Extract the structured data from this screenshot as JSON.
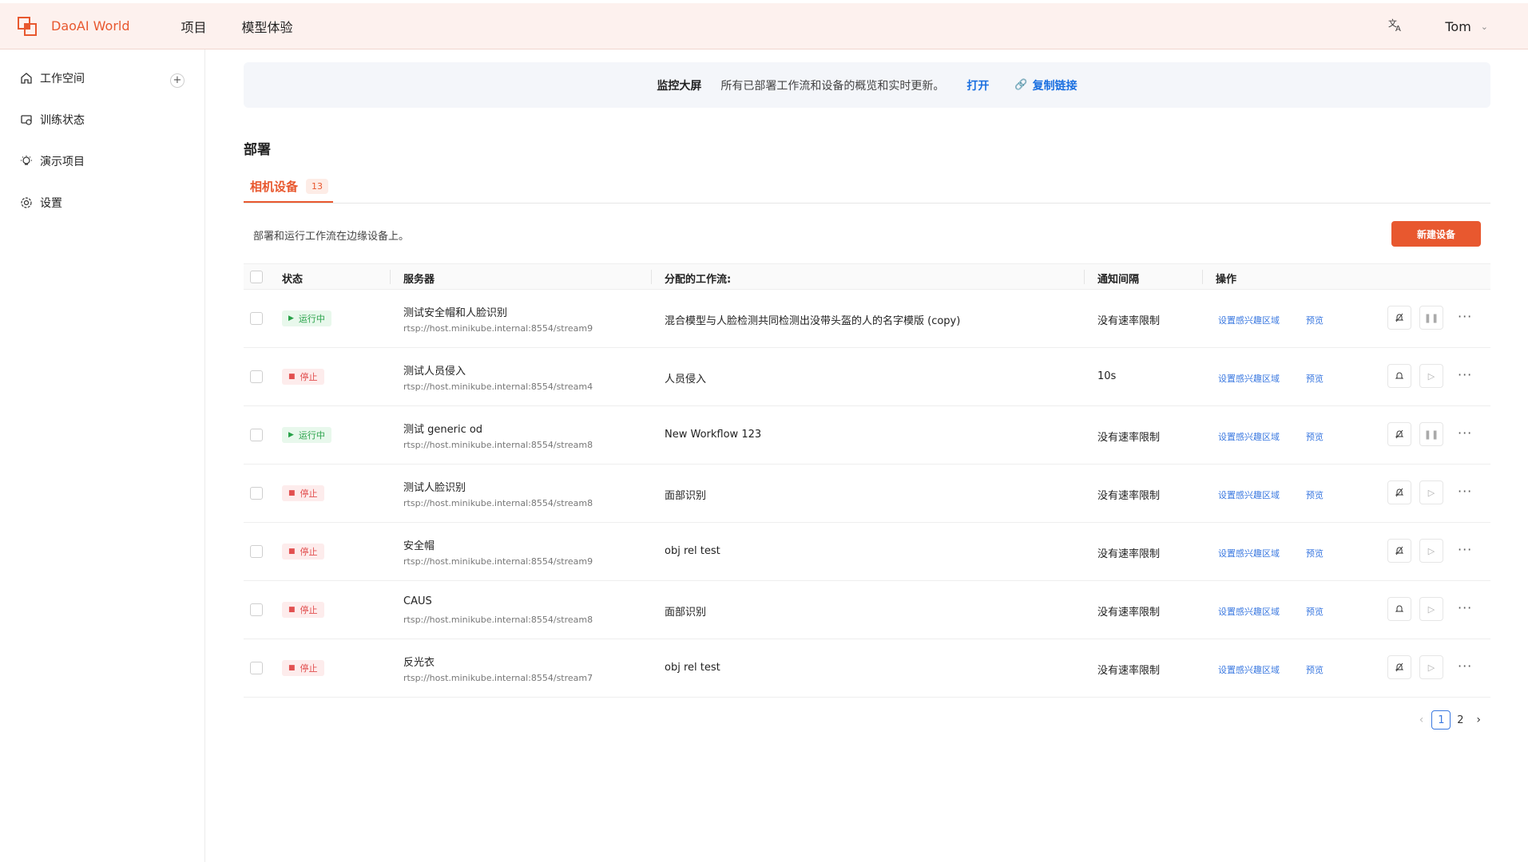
{
  "header": {
    "app_name": "DaoAI World",
    "nav": [
      "项目",
      "模型体验"
    ],
    "user_name": "Tom",
    "lang_icon": "translate-icon"
  },
  "sidebar": {
    "items": [
      {
        "label": "工作空间",
        "icon": "home-icon"
      },
      {
        "label": "训练状态",
        "icon": "training-icon"
      },
      {
        "label": "演示项目",
        "icon": "bulb-icon"
      },
      {
        "label": "设置",
        "icon": "gear-icon"
      }
    ],
    "add_icon": "plus-icon"
  },
  "banner": {
    "title": "监控大屏",
    "desc": "所有已部署工作流和设备的概览和实时更新。",
    "open": "打开",
    "copy": "复制链接"
  },
  "section": {
    "title": "部署",
    "tab_label": "相机设备",
    "tab_count": "13",
    "desc": "部署和运行工作流在边缘设备上。",
    "new_button": "新建设备"
  },
  "table": {
    "headers": {
      "status": "状态",
      "server": "服务器",
      "workflow": "分配的工作流:",
      "interval": "通知间隔",
      "actions": "操作"
    },
    "action_labels": {
      "roi": "设置感兴趣区域",
      "preview": "预览"
    },
    "rows": [
      {
        "status": "运行中",
        "state": "running",
        "name": "测试安全帽和人脸识别",
        "url": "rtsp://host.minikube.internal:8554/stream9",
        "workflow": "混合模型与人脸检测共同检测出没带头盔的人的名字模版 (copy)",
        "interval": "没有速率限制",
        "alert": "bell-off"
      },
      {
        "status": "停止",
        "state": "stopped",
        "name": "测试人员侵入",
        "url": "rtsp://host.minikube.internal:8554/stream4",
        "workflow": "人员侵入",
        "interval": "10s",
        "alert": "bell"
      },
      {
        "status": "运行中",
        "state": "running",
        "name": "测试 generic od",
        "url": "rtsp://host.minikube.internal:8554/stream8",
        "workflow": "New Workflow 123",
        "interval": "没有速率限制",
        "alert": "bell-off"
      },
      {
        "status": "停止",
        "state": "stopped",
        "name": "测试人脸识别",
        "url": "rtsp://host.minikube.internal:8554/stream8",
        "workflow": "面部识别",
        "interval": "没有速率限制",
        "alert": "bell-off"
      },
      {
        "status": "停止",
        "state": "stopped",
        "name": "安全帽",
        "url": "rtsp://host.minikube.internal:8554/stream9",
        "workflow": "obj rel test",
        "interval": "没有速率限制",
        "alert": "bell-off"
      },
      {
        "status": "停止",
        "state": "stopped",
        "name": "CAUS",
        "url": "rtsp://host.minikube.internal:8554/stream8",
        "workflow": "面部识别",
        "interval": "没有速率限制",
        "alert": "bell"
      },
      {
        "status": "停止",
        "state": "stopped",
        "name": "反光衣",
        "url": "rtsp://host.minikube.internal:8554/stream7",
        "workflow": "obj rel test",
        "interval": "没有速率限制",
        "alert": "bell-off"
      }
    ]
  },
  "pagination": {
    "pages": [
      "1",
      "2"
    ],
    "current": "1"
  },
  "colors": {
    "accent": "#e8582f",
    "link": "#3a78e0",
    "running": "#27a148",
    "stopped": "#e25050"
  }
}
